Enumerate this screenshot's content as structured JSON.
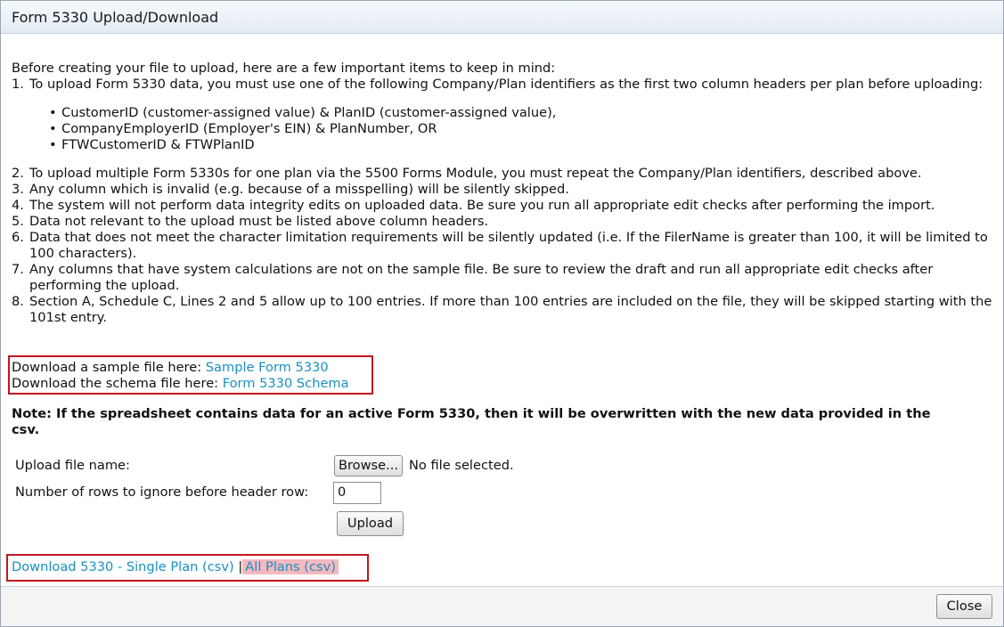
{
  "dialog": {
    "title": "Form 5330 Upload/Download"
  },
  "intro": "Before creating your file to upload, here are a few important items to keep in mind:",
  "item1": {
    "num": "1.",
    "text": "To upload Form 5330 data, you must use one of the following Company/Plan identifiers as the first two column headers per plan before uploading:",
    "identifiers": [
      "CustomerID (customer-assigned value) & PlanID (customer-assigned value),",
      "CompanyEmployerID (Employer's EIN) & PlanNumber, OR",
      "FTWCustomerID & FTWPlanID"
    ]
  },
  "items": [
    {
      "num": "2.",
      "text": "To upload multiple Form 5330s for one plan via the 5500 Forms Module, you must repeat the Company/Plan identifiers, described above."
    },
    {
      "num": "3.",
      "text": "Any column which is invalid (e.g. because of a misspelling) will be silently skipped."
    },
    {
      "num": "4.",
      "text": "The system will not perform data integrity edits on uploaded data. Be sure you run all appropriate edit checks after performing the import."
    },
    {
      "num": "5.",
      "text": "Data not relevant to the upload must be listed above column headers."
    },
    {
      "num": "6.",
      "text": "Data that does not meet the character limitation requirements will be silently updated (i.e. If the FilerName is greater than 100, it will be limited to 100 characters)."
    },
    {
      "num": "7.",
      "text": "Any columns that have system calculations are not on the sample file. Be sure to review the draft and run all appropriate edit checks after performing the upload."
    },
    {
      "num": "8.",
      "text": "Section A, Schedule C, Lines 2 and 5 allow up to 100 entries. If more than 100 entries are included on the file, they will be skipped starting with the 101st entry."
    }
  ],
  "downloads": {
    "sample_prefix": "Download a sample file here: ",
    "sample_link": "Sample Form 5330",
    "schema_prefix": "Download the schema file here: ",
    "schema_link": "Form 5330 Schema"
  },
  "note": "Note: If the spreadsheet contains data for an active Form 5330, then it will be overwritten with the new data provided in the csv.",
  "upload": {
    "file_label": "Upload file name:",
    "browse_label": "Browse...",
    "no_file_text": "No file selected.",
    "rows_label": "Number of rows to ignore before header row:",
    "rows_value": "0",
    "upload_label": "Upload"
  },
  "bottom_links": {
    "single_plan": "Download 5330 - Single Plan (csv)",
    "separator": "|",
    "all_plans": "All Plans (csv)"
  },
  "footer": {
    "close_label": "Close"
  },
  "colors": {
    "link": "#1a8fc0",
    "highlight_border": "#c0171f",
    "highlight_fill": "#f4b9bf"
  }
}
